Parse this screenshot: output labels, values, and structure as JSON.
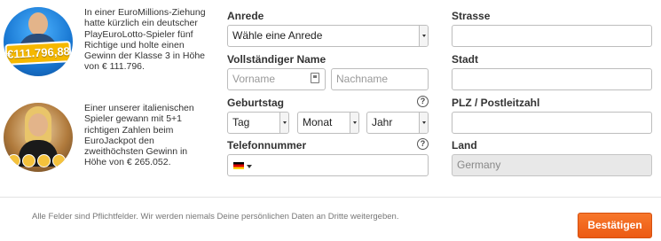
{
  "testimonials": [
    {
      "prize": "€111.796,88",
      "text": "In einer EuroMillions-Ziehung hatte kürzlich ein deutscher PlayEuroLotto-Spieler fünf Richtige und holte einen Gewinn der Klasse 3 in Höhe von € 111.796."
    },
    {
      "text": "Einer unserer italienischen Spieler gewann mit 5+1 richtigen Zahlen beim EuroJackpot den zweithöchsten Gewinn in Höhe von € 265.052."
    }
  ],
  "form": {
    "anrede": {
      "label": "Anrede",
      "value": "Wähle eine Anrede"
    },
    "name": {
      "label": "Vollständiger Name",
      "first_placeholder": "Vorname",
      "last_placeholder": "Nachname"
    },
    "geburtstag": {
      "label": "Geburtstag",
      "help": "?",
      "day": "Tag",
      "month": "Monat",
      "year": "Jahr"
    },
    "telefon": {
      "label": "Telefonnummer",
      "help": "?",
      "value": ""
    },
    "strasse": {
      "label": "Strasse",
      "value": ""
    },
    "stadt": {
      "label": "Stadt",
      "value": ""
    },
    "plz": {
      "label": "PLZ / Postleitzahl",
      "value": ""
    },
    "land": {
      "label": "Land",
      "value": "Germany"
    }
  },
  "footer": {
    "note": "Alle Felder sind Pflichtfelder. Wir werden niemals Deine persönlichen Daten an Dritte weitergeben.",
    "submit_label": "Bestätigen"
  },
  "colors": {
    "accent": "#f26a1f",
    "prize_badge": "#f5b800"
  }
}
